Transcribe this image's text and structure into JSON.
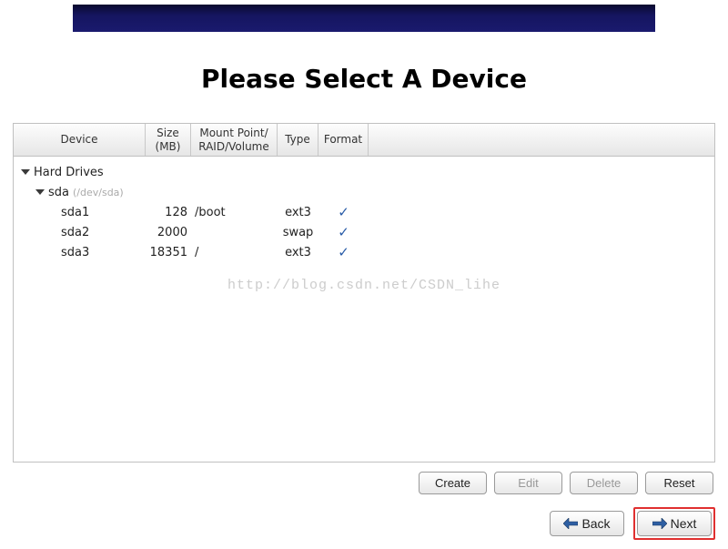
{
  "title": "Please Select A Device",
  "columns": {
    "device": "Device",
    "size": "Size\n(MB)",
    "mount": "Mount Point/\nRAID/Volume",
    "type": "Type",
    "format": "Format"
  },
  "tree": {
    "root": "Hard Drives",
    "disk": {
      "name": "sda",
      "path": "(/dev/sda)"
    },
    "partitions": [
      {
        "name": "sda1",
        "size": "128",
        "mount": "/boot",
        "type": "ext3",
        "format": true
      },
      {
        "name": "sda2",
        "size": "2000",
        "mount": "",
        "type": "swap",
        "format": true
      },
      {
        "name": "sda3",
        "size": "18351",
        "mount": "/",
        "type": "ext3",
        "format": true
      }
    ]
  },
  "watermark": "http://blog.csdn.net/CSDN_lihe",
  "actions": {
    "create": "Create",
    "edit": "Edit",
    "delete": "Delete",
    "reset": "Reset"
  },
  "nav": {
    "back": "Back",
    "next": "Next"
  }
}
